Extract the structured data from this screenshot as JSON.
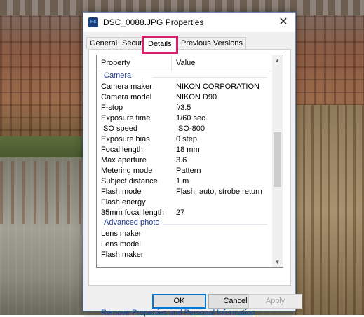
{
  "window": {
    "title": "DSC_0088.JPG Properties",
    "app_icon": "Ps",
    "close_symbol": "✕"
  },
  "tabs": [
    {
      "label": "General",
      "active": false
    },
    {
      "label": "Security",
      "active": false
    },
    {
      "label": "Details",
      "active": true
    },
    {
      "label": "Previous Versions",
      "active": false
    }
  ],
  "details": {
    "header": {
      "property": "Property",
      "value": "Value"
    },
    "groups": [
      {
        "name": "Camera",
        "rows": [
          {
            "property": "Camera maker",
            "value": "NIKON CORPORATION"
          },
          {
            "property": "Camera model",
            "value": "NIKON D90"
          },
          {
            "property": "F-stop",
            "value": "f/3.5"
          },
          {
            "property": "Exposure time",
            "value": "1/60 sec."
          },
          {
            "property": "ISO speed",
            "value": "ISO-800"
          },
          {
            "property": "Exposure bias",
            "value": "0 step"
          },
          {
            "property": "Focal length",
            "value": "18 mm"
          },
          {
            "property": "Max aperture",
            "value": "3.6"
          },
          {
            "property": "Metering mode",
            "value": "Pattern"
          },
          {
            "property": "Subject distance",
            "value": "1 m"
          },
          {
            "property": "Flash mode",
            "value": "Flash, auto, strobe return"
          },
          {
            "property": "Flash energy",
            "value": ""
          },
          {
            "property": "35mm focal length",
            "value": "27"
          }
        ]
      },
      {
        "name": "Advanced photo",
        "rows": [
          {
            "property": "Lens maker",
            "value": ""
          },
          {
            "property": "Lens model",
            "value": ""
          },
          {
            "property": "Flash maker",
            "value": ""
          }
        ]
      }
    ]
  },
  "remove_link": "Remove Properties and Personal Information",
  "buttons": {
    "ok": "OK",
    "cancel": "Cancel",
    "apply": "Apply"
  },
  "colors": {
    "highlight": "#d6206b",
    "group_header": "#1e3a8a",
    "link": "#0645ad"
  }
}
